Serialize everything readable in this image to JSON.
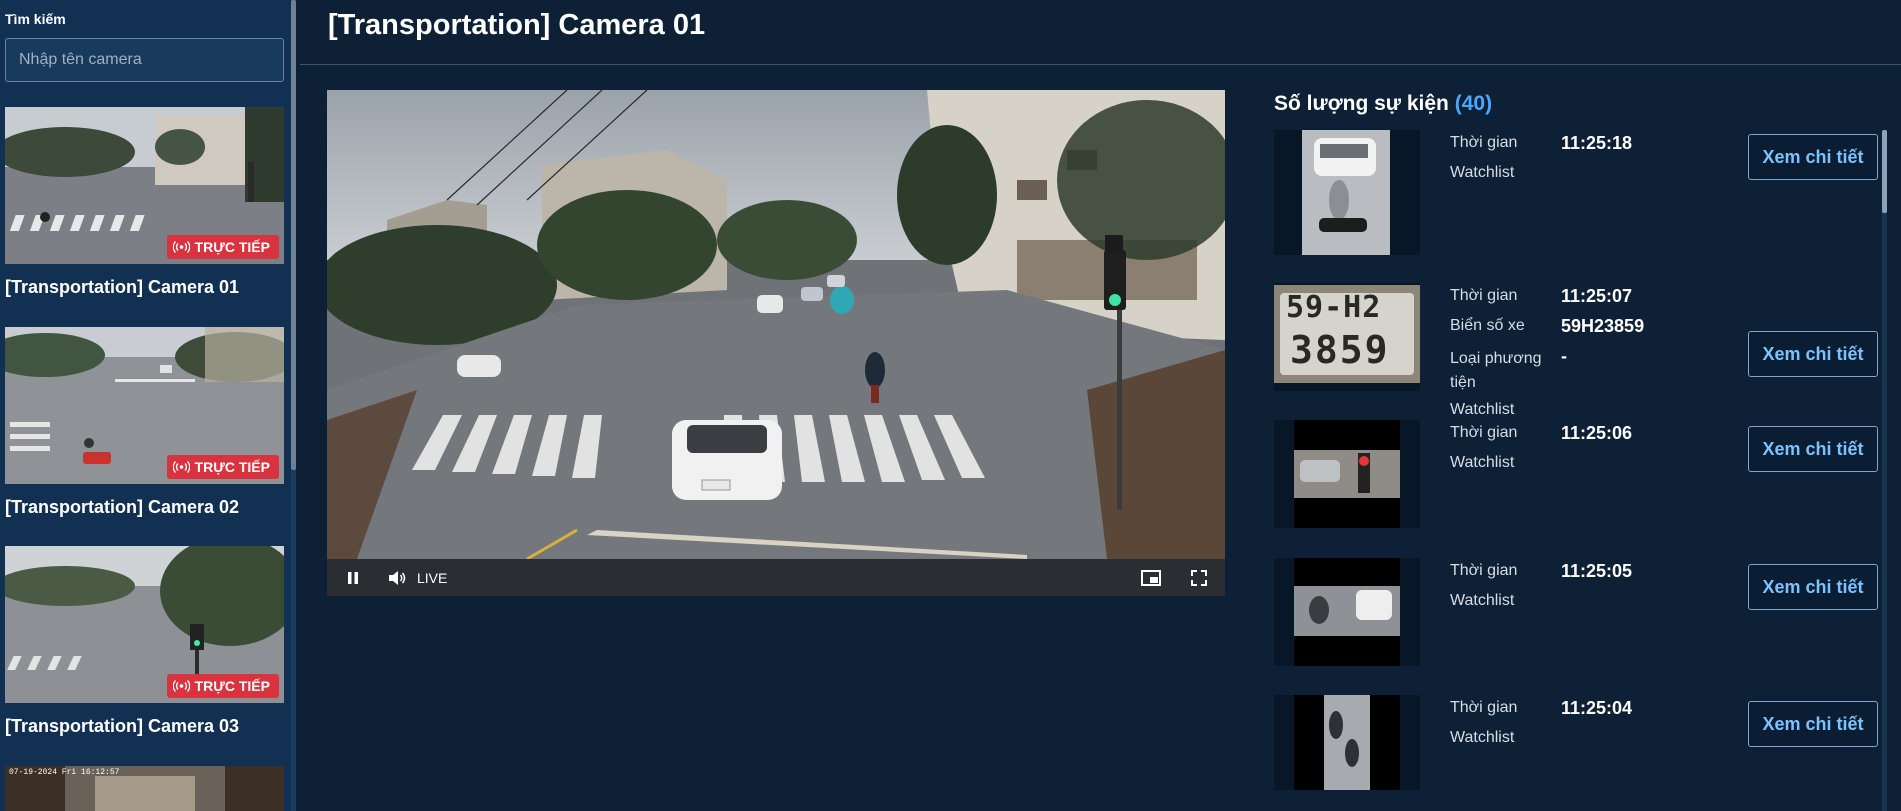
{
  "sidebar": {
    "search_label": "Tìm kiếm",
    "search_placeholder": "Nhập tên camera",
    "cameras": [
      {
        "title": "[Transportation] Camera 01",
        "badge": "TRỰC TIẾP"
      },
      {
        "title": "[Transportation] Camera 02",
        "badge": "TRỰC TIẾP"
      },
      {
        "title": "[Transportation] Camera 03",
        "badge": "TRỰC TIẾP"
      },
      {
        "overlay_text": "07-19-2024 Fri 16:12:57"
      }
    ]
  },
  "header": {
    "title": "[Transportation] Camera 01"
  },
  "player": {
    "live_label": "LIVE"
  },
  "events": {
    "title": "Số lượng sự kiện",
    "count": "(40)",
    "button_label": "Xem chi tiết",
    "items": [
      {
        "time_label": "Thời gian",
        "time": "11:25:18",
        "watchlist_label": "Watchlist"
      },
      {
        "time_label": "Thời gian",
        "time": "11:25:07",
        "plate_label": "Biển số xe",
        "plate": "59H23859",
        "vehicle_label": "Loại phương tiện",
        "vehicle": "-",
        "watchlist_label": "Watchlist",
        "plate_text_top": "59-H2",
        "plate_text_bottom": "3859"
      },
      {
        "time_label": "Thời gian",
        "time": "11:25:06",
        "watchlist_label": "Watchlist"
      },
      {
        "time_label": "Thời gian",
        "time": "11:25:05",
        "watchlist_label": "Watchlist"
      },
      {
        "time_label": "Thời gian",
        "time": "11:25:04",
        "watchlist_label": "Watchlist"
      }
    ]
  },
  "colors": {
    "background": "#0d2036",
    "sidebar": "#123051",
    "accent": "#4aa8ff",
    "live_badge": "#d9333f"
  }
}
